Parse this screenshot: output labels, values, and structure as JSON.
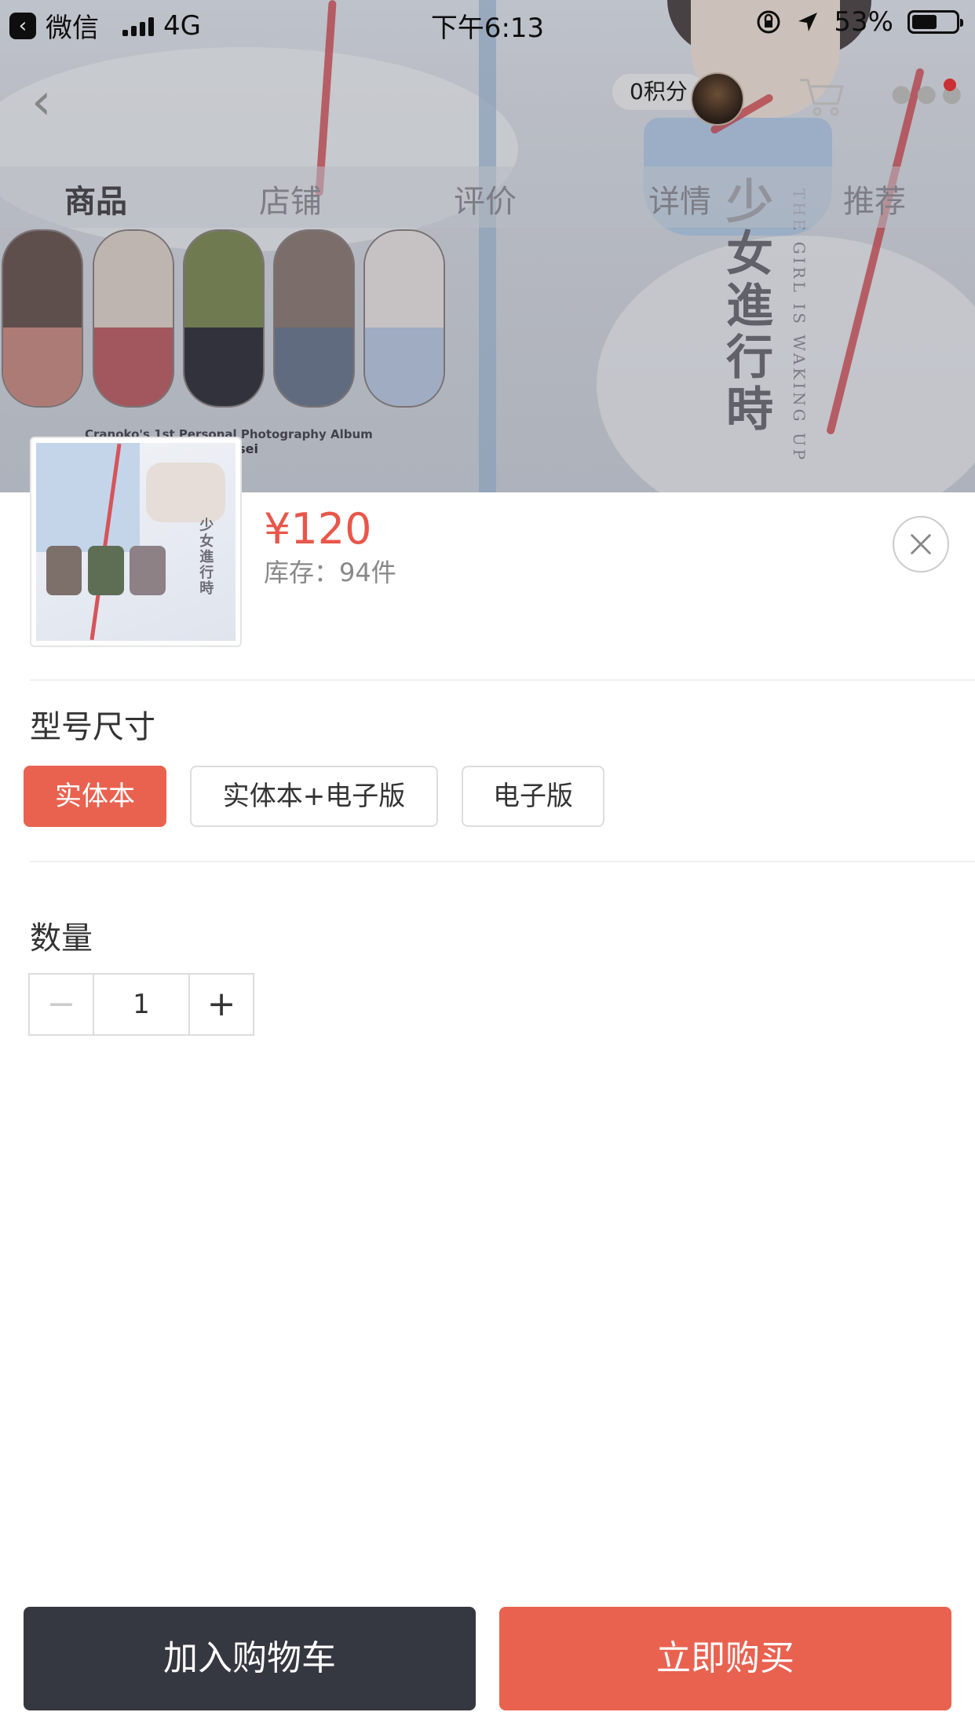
{
  "status_bar": {
    "back_app": "微信",
    "network": "4G",
    "time": "下午6:13",
    "battery": "53%"
  },
  "navbar": {
    "points": "0积分"
  },
  "tabs": [
    {
      "label": "商品",
      "active": true
    },
    {
      "label": "店铺",
      "active": false
    },
    {
      "label": "评价",
      "active": false
    },
    {
      "label": "详情",
      "active": false
    },
    {
      "label": "推荐",
      "active": false
    }
  ],
  "background_art": {
    "title_vertical": "少女進行時",
    "subtitle_en": "THE GIRL IS WAKING UP",
    "album_line_1": "Cranoko's 1st Personal Photography Album",
    "album_line_2": "Koukousei"
  },
  "product": {
    "price": "¥120",
    "stock": "库存：94件"
  },
  "spec": {
    "label": "型号尺寸",
    "options": [
      {
        "label": "实体本",
        "selected": true
      },
      {
        "label": "实体本+电子版",
        "selected": false
      },
      {
        "label": "电子版",
        "selected": false
      }
    ]
  },
  "quantity": {
    "label": "数量",
    "minus": "−",
    "value": "1",
    "plus": "+"
  },
  "actions": {
    "add_to_cart": "加入购物车",
    "buy_now": "立即购买"
  },
  "colors": {
    "accent": "#e96250",
    "dark_button": "#353840",
    "price": "#e8574a"
  }
}
